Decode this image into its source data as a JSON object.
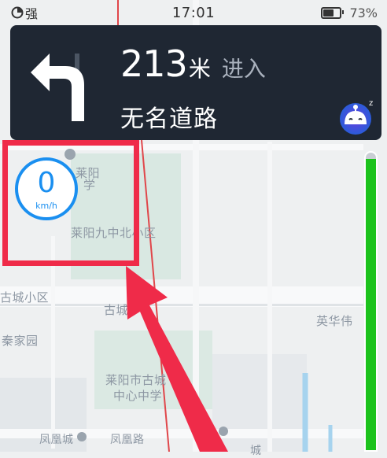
{
  "status_bar": {
    "signal_label": "强",
    "time": "17:01",
    "battery_percent": "73%",
    "battery_level": 0.73
  },
  "navigation": {
    "distance_value": "213",
    "distance_unit": "米",
    "action": "进入",
    "road_name": "无名道路",
    "turn_direction": "left"
  },
  "speed": {
    "value": "0",
    "unit": "km/h"
  },
  "route_progress": 0.98,
  "map": {
    "labels": {
      "laiyang_school_1": "莱阳",
      "laiyang_school_2": "学",
      "jiuzhong_district": "莱阳九中北小区",
      "gucheng_district": "古城小区",
      "gucheng_label": "古城",
      "qinjia_garden": "秦家园",
      "yinghua": "英华伟",
      "gucheng_school_1": "莱阳市古城",
      "gucheng_school_2": "中心中学",
      "fenghuang_city": "凤凰城",
      "fenghuang_road": "凤凰路",
      "city_fragment": "城"
    }
  },
  "colors": {
    "panel_bg": "#1f2733",
    "speed_blue": "#1a8ff0",
    "progress_green": "#1cc31c",
    "highlight_red": "#ef2b49"
  }
}
